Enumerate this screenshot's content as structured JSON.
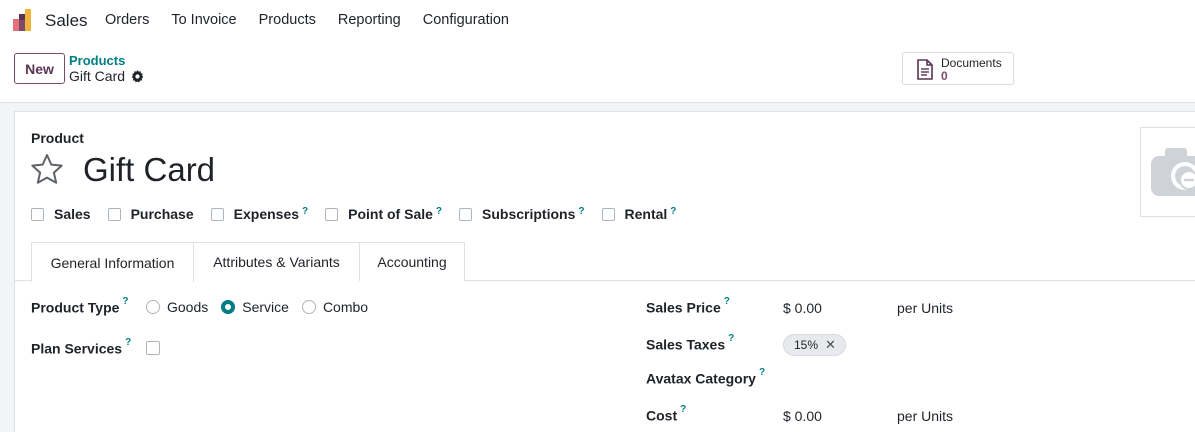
{
  "navbar": {
    "app_name": "Sales",
    "menu": [
      "Orders",
      "To Invoice",
      "Products",
      "Reporting",
      "Configuration"
    ]
  },
  "control_panel": {
    "new_label": "New",
    "breadcrumb_parent": "Products",
    "breadcrumb_current": "Gift Card",
    "documents_label": "Documents",
    "documents_count": "0"
  },
  "form": {
    "product_label": "Product",
    "product_name": "Gift Card",
    "checkboxes": [
      {
        "label": "Sales",
        "help": "",
        "checked": false
      },
      {
        "label": "Purchase",
        "help": "",
        "checked": false
      },
      {
        "label": "Expenses",
        "help": "?",
        "checked": false
      },
      {
        "label": "Point of Sale",
        "help": "?",
        "checked": false
      },
      {
        "label": "Subscriptions",
        "help": "?",
        "checked": false
      },
      {
        "label": "Rental",
        "help": "?",
        "checked": false
      }
    ],
    "tabs": [
      "General Information",
      "Attributes & Variants",
      "Accounting"
    ],
    "active_tab": "General Information",
    "product_type_label": "Product Type",
    "product_type_options": [
      "Goods",
      "Service",
      "Combo"
    ],
    "product_type_selected": "Service",
    "plan_services_label": "Plan Services",
    "help_mark": "?",
    "sales_price_label": "Sales Price",
    "sales_price_value": "$ 0.00",
    "sales_price_unit": "per Units",
    "sales_taxes_label": "Sales Taxes",
    "sales_tax_badge": "15%",
    "avatax_label": "Avatax Category",
    "cost_label": "Cost",
    "cost_value": "$ 0.00",
    "cost_unit": "per Units"
  },
  "colors": {
    "accent": "#017e84",
    "brand": "#7c4b6b",
    "badge_bg": "#e7e9ed"
  }
}
